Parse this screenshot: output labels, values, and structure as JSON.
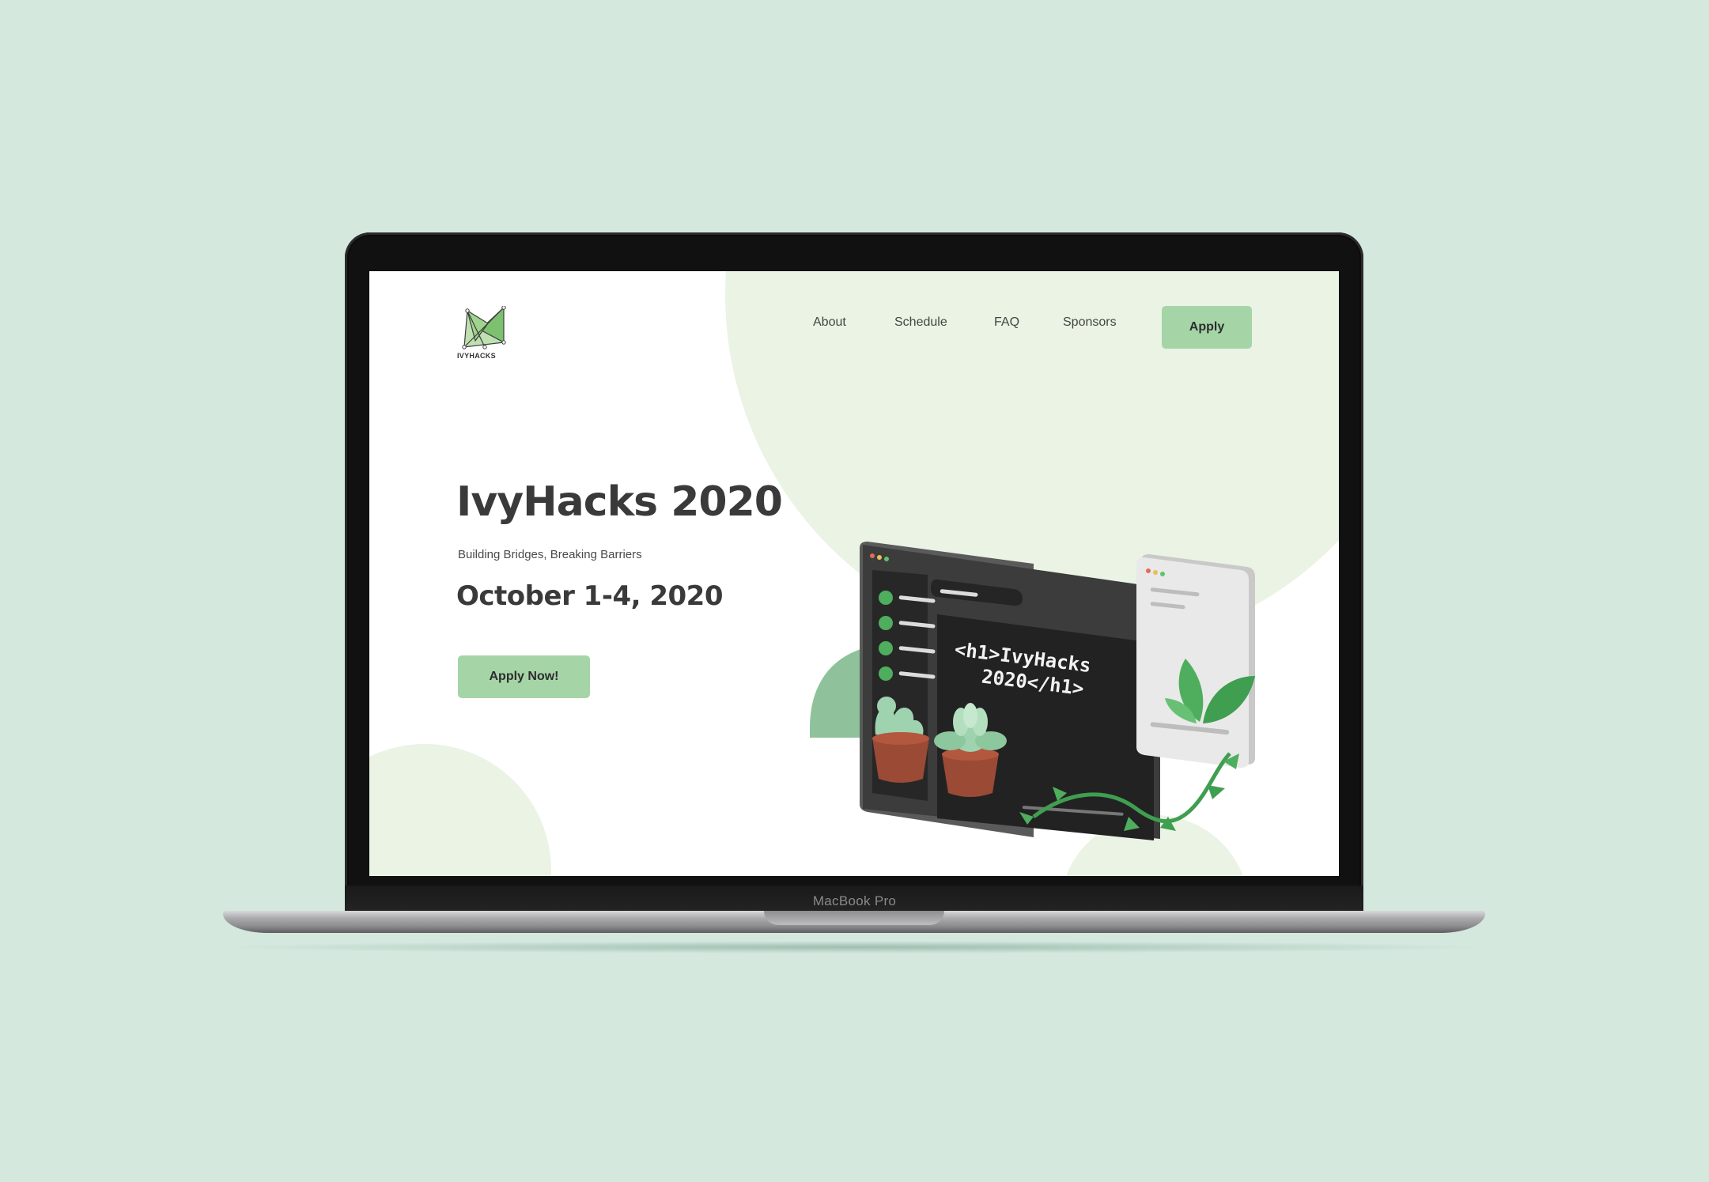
{
  "device": {
    "label": "MacBook Pro"
  },
  "site": {
    "logo_text": "IVYHACKS",
    "nav": {
      "about": "About",
      "schedule": "Schedule",
      "faq": "FAQ",
      "sponsors": "Sponsors",
      "apply": "Apply"
    },
    "hero": {
      "title": "IvyHacks 2020",
      "subtitle": "Building Bridges, Breaking Barriers",
      "date": "October 1-4, 2020",
      "cta": "Apply Now!"
    },
    "illustration": {
      "code_line_1": "<h1>IvyHacks",
      "code_line_2": "2020</h1>"
    }
  },
  "colors": {
    "background": "#d4e8de",
    "accent_button": "#a5d5a7",
    "blob": "#eaf3e4",
    "text_dark": "#3a3a3a"
  }
}
